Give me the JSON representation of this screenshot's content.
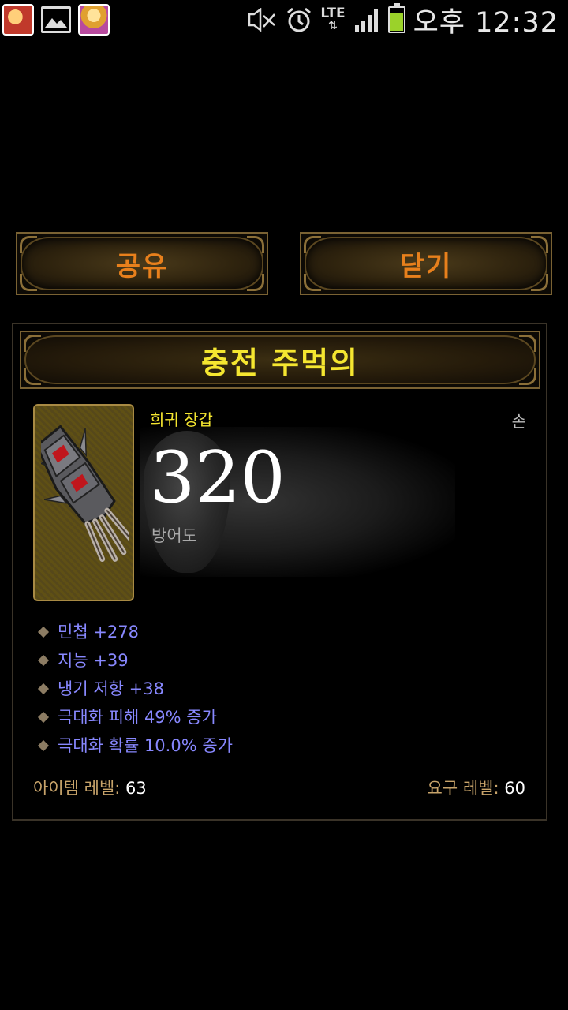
{
  "status_bar": {
    "notification_icons": [
      "game-avatar-icon",
      "gallery-icon",
      "game-avatar-icon"
    ],
    "system_icons": [
      "mute-icon",
      "alarm-icon",
      "lte-data-icon",
      "signal-icon",
      "battery-icon"
    ],
    "network": "LTE",
    "time": "오후 12:32",
    "battery_color": "#9bd22a"
  },
  "buttons": {
    "share": "공유",
    "close": "닫기"
  },
  "item": {
    "name": "충전 주먹의",
    "type": "희귀 장갑",
    "slot": "손",
    "armor_value": "320",
    "armor_label": "방어도",
    "affixes": [
      {
        "text": "민첩 +278"
      },
      {
        "text": "지능 +39"
      },
      {
        "text": "냉기 저항 +38"
      },
      {
        "text": "극대화 피해 49% 증가"
      },
      {
        "text": "극대화 확률 10.0% 증가"
      }
    ],
    "item_level_label": "아이템 레벨:",
    "item_level": "63",
    "required_level_label": "요구 레벨:",
    "required_level": "60"
  },
  "colors": {
    "item_name": "#f5e630",
    "button_text": "#e8801c",
    "affix_text": "#8888ff",
    "footer_label": "#c7a36a"
  }
}
